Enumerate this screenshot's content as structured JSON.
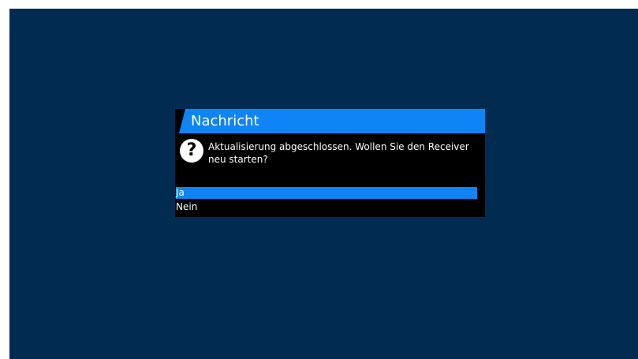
{
  "dialog": {
    "title": "Nachricht",
    "icon": "question-icon",
    "icon_glyph": "?",
    "message": "Aktualisierung abgeschlossen. Wollen Sie den Receiver neu starten?",
    "options": [
      {
        "label": "Ja",
        "selected": true
      },
      {
        "label": "Nein",
        "selected": false
      }
    ]
  },
  "colors": {
    "background": "#022b52",
    "accent": "#0f84f4",
    "dialog_body": "#000000"
  }
}
